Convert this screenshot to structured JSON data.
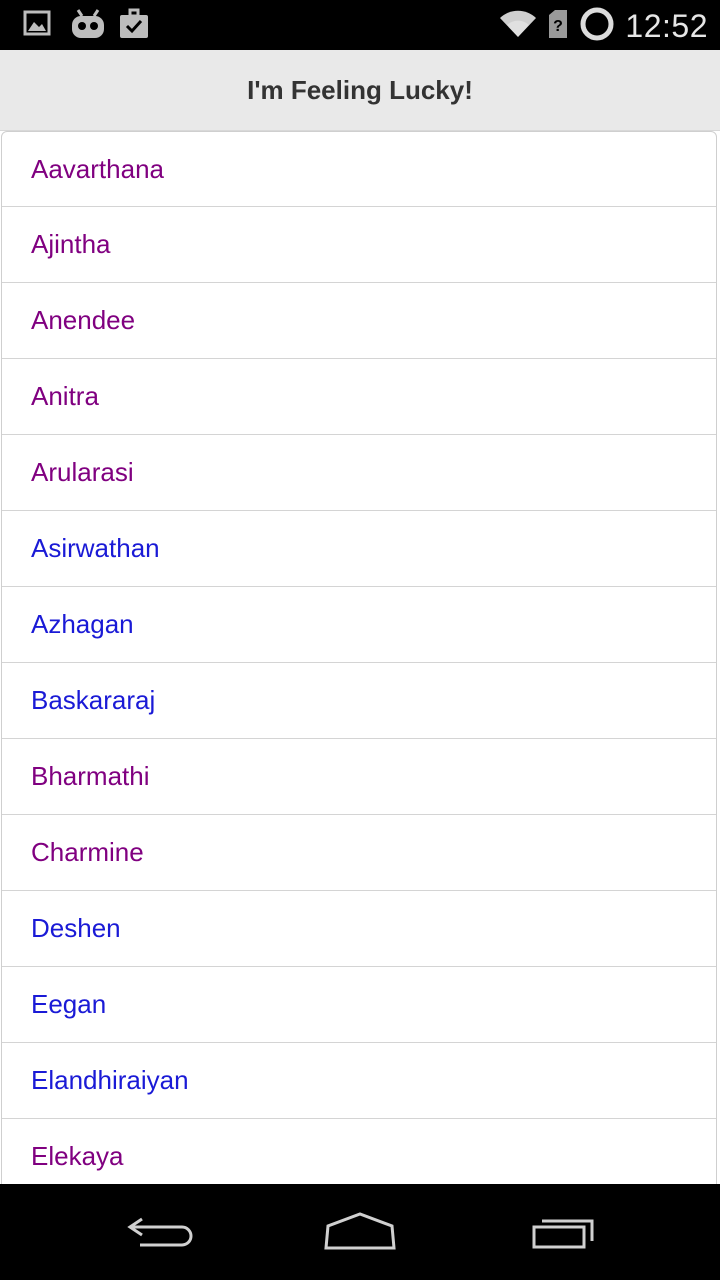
{
  "status_bar": {
    "time": "12:52",
    "icons": [
      "image-notification-icon",
      "cyanogen-mascot-icon",
      "task-checklist-icon",
      "wifi-icon",
      "no-sim-icon",
      "battery-ring-icon"
    ]
  },
  "header": {
    "title": "I'm Feeling Lucky!"
  },
  "colors": {
    "visited_link": "#800080",
    "unvisited_link": "#1a1ad6",
    "header_bg": "#e9e9e9",
    "bar_bg": "#000000"
  },
  "list": {
    "items": [
      {
        "label": "Aavarthana",
        "visited": true
      },
      {
        "label": "Ajintha",
        "visited": true
      },
      {
        "label": "Anendee",
        "visited": true
      },
      {
        "label": "Anitra",
        "visited": true
      },
      {
        "label": "Arularasi",
        "visited": true
      },
      {
        "label": "Asirwathan",
        "visited": false
      },
      {
        "label": "Azhagan",
        "visited": false
      },
      {
        "label": "Baskararaj",
        "visited": false
      },
      {
        "label": "Bharmathi",
        "visited": true
      },
      {
        "label": "Charmine",
        "visited": true
      },
      {
        "label": "Deshen",
        "visited": false
      },
      {
        "label": "Eegan",
        "visited": false
      },
      {
        "label": "Elandhiraiyan",
        "visited": false
      },
      {
        "label": "Elekaya",
        "visited": true
      }
    ]
  },
  "nav_bar": {
    "buttons": [
      "back-icon",
      "home-icon",
      "recents-icon"
    ]
  }
}
